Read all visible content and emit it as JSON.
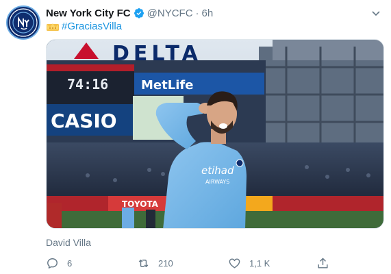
{
  "tweet": {
    "author_name": "New York City FC",
    "handle": "@NYCFC",
    "separator": "·",
    "time": "6h",
    "crown_icon": "crown-icon",
    "hashtag": "#GraciasVilla",
    "media_caption": "David Villa",
    "stadium_signs": {
      "delta": "DELTA",
      "metlife": "MetLife",
      "casio": "CASIO",
      "toyota": "TOYOTA",
      "scoreboard_time": "74:16"
    },
    "jersey_text": {
      "sponsor": "etihad",
      "sponsor_sub": "AIRWAYS"
    }
  },
  "actions": {
    "reply_count": "6",
    "retweet_count": "210",
    "like_count": "1,1 K"
  },
  "colors": {
    "link": "#1b95e0",
    "muted": "#657786",
    "club_navy": "#0f2d6e",
    "club_sky": "#6cace4"
  }
}
